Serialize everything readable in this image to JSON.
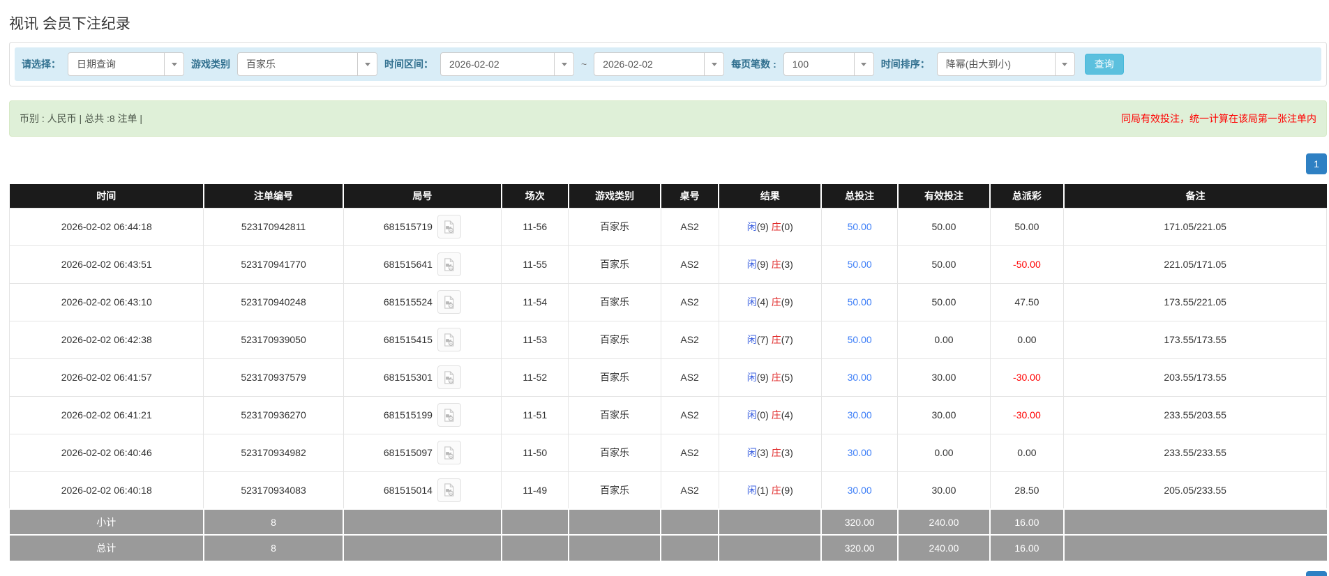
{
  "page": {
    "title": "视讯 会员下注纪录"
  },
  "filters": {
    "select_label": "请选择：",
    "select_value": "日期查询",
    "game_type_label": "游戏类别",
    "game_type_value": "百家乐",
    "time_range_label": "时间区间：",
    "date_from": "2026-02-02",
    "tilde": "~",
    "date_to": "2026-02-02",
    "page_size_label": "每页笔数 :",
    "page_size_value": "100",
    "sort_label": "时间排序：",
    "sort_value": "降幂(由大到小)",
    "query_button": "查询"
  },
  "summary_bar": {
    "left_text": "币别 : 人民币 | 总共 :8 注单 |",
    "right_text": "同局有效投注，统一计算在该局第一张注单内"
  },
  "pagination": {
    "current_page": "1"
  },
  "table": {
    "headers": [
      "时间",
      "注单编号",
      "局号",
      "场次",
      "游戏类别",
      "桌号",
      "结果",
      "总投注",
      "有效投注",
      "总派彩",
      "备注"
    ],
    "rows": [
      {
        "time": "2026-02-02 06:44:18",
        "bet_id": "523170942811",
        "round_id": "681515719",
        "session": "11-56",
        "game": "百家乐",
        "table_no": "AS2",
        "player_label": "闲",
        "player_score": "(9)",
        "banker_label": "庄",
        "banker_score": "(0)",
        "total_bet": "50.00",
        "valid_bet": "50.00",
        "payout": "50.00",
        "remark": "171.05/221.05"
      },
      {
        "time": "2026-02-02 06:43:51",
        "bet_id": "523170941770",
        "round_id": "681515641",
        "session": "11-55",
        "game": "百家乐",
        "table_no": "AS2",
        "player_label": "闲",
        "player_score": "(9)",
        "banker_label": "庄",
        "banker_score": "(3)",
        "total_bet": "50.00",
        "valid_bet": "50.00",
        "payout": "-50.00",
        "remark": "221.05/171.05"
      },
      {
        "time": "2026-02-02 06:43:10",
        "bet_id": "523170940248",
        "round_id": "681515524",
        "session": "11-54",
        "game": "百家乐",
        "table_no": "AS2",
        "player_label": "闲",
        "player_score": "(4)",
        "banker_label": "庄",
        "banker_score": "(9)",
        "total_bet": "50.00",
        "valid_bet": "50.00",
        "payout": "47.50",
        "remark": "173.55/221.05"
      },
      {
        "time": "2026-02-02 06:42:38",
        "bet_id": "523170939050",
        "round_id": "681515415",
        "session": "11-53",
        "game": "百家乐",
        "table_no": "AS2",
        "player_label": "闲",
        "player_score": "(7)",
        "banker_label": "庄",
        "banker_score": "(7)",
        "total_bet": "50.00",
        "valid_bet": "0.00",
        "payout": "0.00",
        "remark": "173.55/173.55"
      },
      {
        "time": "2026-02-02 06:41:57",
        "bet_id": "523170937579",
        "round_id": "681515301",
        "session": "11-52",
        "game": "百家乐",
        "table_no": "AS2",
        "player_label": "闲",
        "player_score": "(9)",
        "banker_label": "庄",
        "banker_score": "(5)",
        "total_bet": "30.00",
        "valid_bet": "30.00",
        "payout": "-30.00",
        "remark": "203.55/173.55"
      },
      {
        "time": "2026-02-02 06:41:21",
        "bet_id": "523170936270",
        "round_id": "681515199",
        "session": "11-51",
        "game": "百家乐",
        "table_no": "AS2",
        "player_label": "闲",
        "player_score": "(0)",
        "banker_label": "庄",
        "banker_score": "(4)",
        "total_bet": "30.00",
        "valid_bet": "30.00",
        "payout": "-30.00",
        "remark": "233.55/203.55"
      },
      {
        "time": "2026-02-02 06:40:46",
        "bet_id": "523170934982",
        "round_id": "681515097",
        "session": "11-50",
        "game": "百家乐",
        "table_no": "AS2",
        "player_label": "闲",
        "player_score": "(3)",
        "banker_label": "庄",
        "banker_score": "(3)",
        "total_bet": "30.00",
        "valid_bet": "0.00",
        "payout": "0.00",
        "remark": "233.55/233.55"
      },
      {
        "time": "2026-02-02 06:40:18",
        "bet_id": "523170934083",
        "round_id": "681515014",
        "session": "11-49",
        "game": "百家乐",
        "table_no": "AS2",
        "player_label": "闲",
        "player_score": "(1)",
        "banker_label": "庄",
        "banker_score": "(9)",
        "total_bet": "30.00",
        "valid_bet": "30.00",
        "payout": "28.50",
        "remark": "205.05/233.55"
      }
    ],
    "subtotal": {
      "label": "小计",
      "count": "8",
      "total_bet": "320.00",
      "valid_bet": "240.00",
      "payout": "16.00"
    },
    "total": {
      "label": "总计",
      "count": "8",
      "total_bet": "320.00",
      "valid_bet": "240.00",
      "payout": "16.00"
    }
  },
  "icons": {
    "dropdown": "caret-down-icon",
    "video": "video-file-icon"
  },
  "colors": {
    "filter_bar_bg": "#d9edf7",
    "filter_label": "#31708f",
    "query_button_bg": "#5bc0de",
    "notice_bar_bg": "#dff0d8",
    "notice_red": "#ff0000",
    "pagination_active": "#2e80c3",
    "table_header_bg": "#1b1b1b",
    "summary_row_bg": "#9a9a9a",
    "player_blue": "#3a5fe0",
    "banker_red": "#e02b2b",
    "bet_link_blue": "#3d7ef7",
    "negative_red": "#ff0000"
  }
}
